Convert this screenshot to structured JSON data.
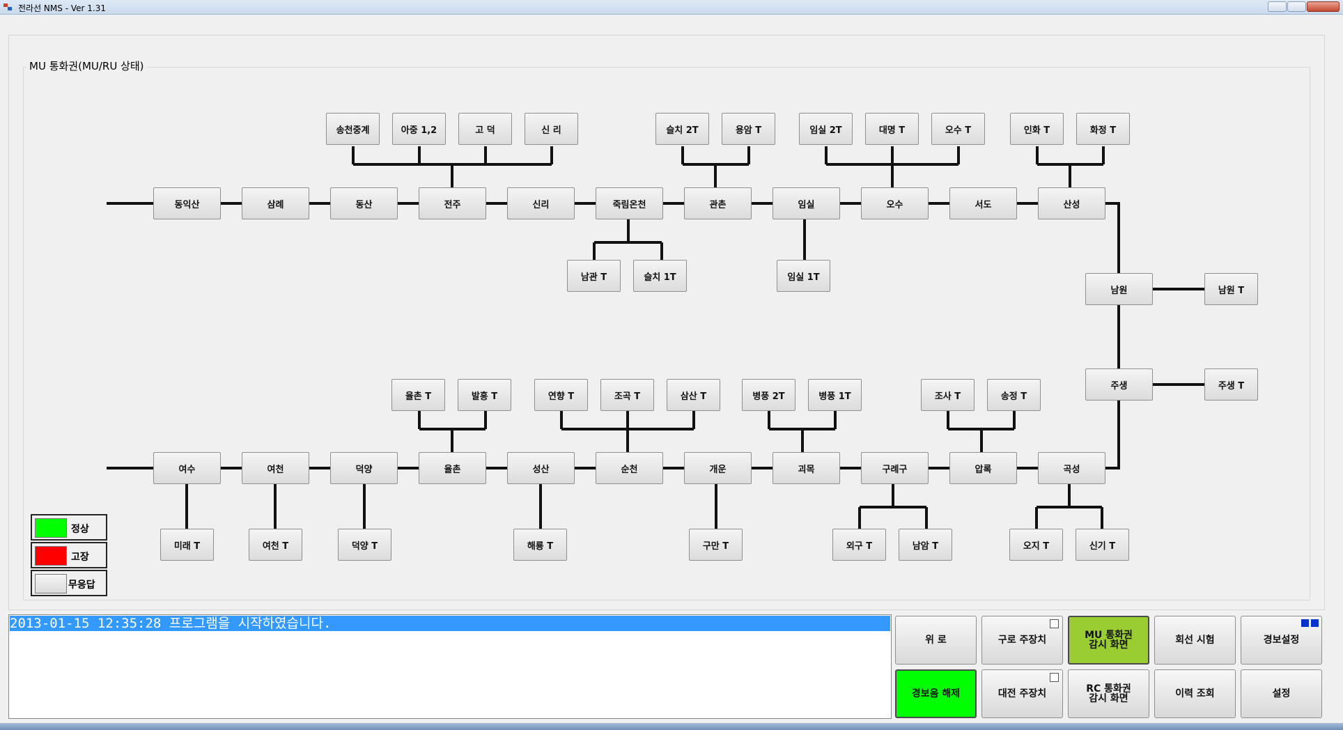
{
  "window": {
    "title": "전라선 NMS  - Ver 1.31"
  },
  "group": {
    "label": "MU 통화권(MU/RU 상태)"
  },
  "colors": {
    "normal": "#00ff00",
    "fault": "#ff0000",
    "no_response": "#e6e6e6",
    "selected_button": "#9ACD32",
    "alarm_button": "#00ff00"
  },
  "stations_top": {
    "dongiksan": "동익산",
    "samrye": "삼례",
    "dongsan": "동산",
    "jeonju": "전주",
    "sinri": "신리",
    "jukrimoncheon": "죽림온천",
    "gwanchon": "관촌",
    "imsil": "임실",
    "osu": "오수",
    "seodo": "서도",
    "sanseong": "산성"
  },
  "stations_right": {
    "namwon": "남원",
    "jusaeng": "주생"
  },
  "stations_bottom": {
    "yeosu": "여수",
    "yeocheon": "여천",
    "deogyang": "덕양",
    "yulchon": "율촌",
    "seongsan": "성산",
    "suncheon": "순천",
    "gaeun": "개운",
    "goemok": "괴목",
    "guryegu": "구례구",
    "amnok": "압록",
    "gokseong": "곡성"
  },
  "terminals_top": {
    "songcheon": "송천중계",
    "ajung": "아중 1,2",
    "godeok": "고 덕",
    "sinri_t": "신 리",
    "seulchi2": "슬치 2T",
    "yongam": "용암 T",
    "imsil2": "임실 2T",
    "daemyeong": "대명 T",
    "osu_t": "오수 T",
    "inhwa": "인화 T",
    "hwajeong": "화정 T",
    "namgwan": "남관 T",
    "seulchi1": "슬치 1T",
    "imsil1": "임실 1T",
    "namwon_t": "남원 T",
    "jusaeng_t": "주생 T"
  },
  "terminals_bottom": {
    "yulchon_t": "율촌 T",
    "balheung": "발흥 T",
    "yeonhyang": "연향 T",
    "jogok": "조곡 T",
    "samsan": "삼산 T",
    "byeongpung2": "병풍 2T",
    "byeongpung1": "병풍 1T",
    "josa": "조사 T",
    "songjeong": "송정 T",
    "mirae": "미래 T",
    "yeocheon_t": "여천 T",
    "deogyang_t": "덕양 T",
    "haeryong": "해룡 T",
    "guman": "구만 T",
    "oegu": "외구 T",
    "namam": "남암 T",
    "oji": "오지 T",
    "singi": "신기 T"
  },
  "legend": [
    {
      "label": "정상",
      "state": "normal"
    },
    {
      "label": "고장",
      "state": "fault"
    },
    {
      "label": "무응답",
      "state": "no_response"
    }
  ],
  "log": {
    "lines": [
      "2013-01-15 12:35:28 프로그램을 시작하였습니다."
    ]
  },
  "buttons": {
    "wiro": "위 로",
    "guro": "구로 주장치",
    "mu_line1": "MU 통화권",
    "mu_line2": "감시 화면",
    "circuit_test": "회선 시험",
    "alarm_settings": "경보설정",
    "alarm_release": "경보음 해제",
    "daejeon": "대전 주장치",
    "rc_line1": "RC 통화권",
    "rc_line2": "감시 화면",
    "history": "이력 조회",
    "settings": "설정"
  }
}
